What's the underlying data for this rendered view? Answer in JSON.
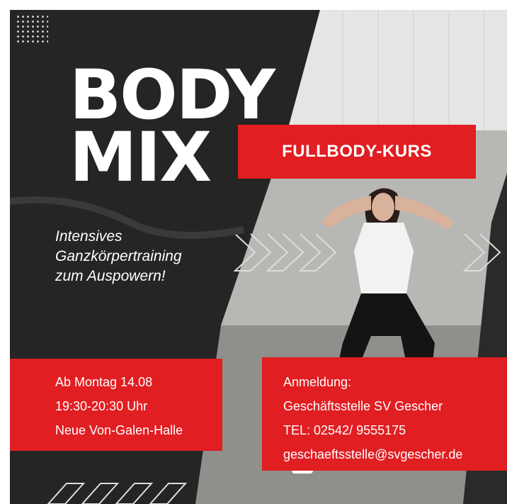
{
  "poster": {
    "title_line1": "BODY",
    "title_line2": "MIX",
    "badge": "FULLBODY-KURS",
    "tagline": [
      "Intensives",
      "Ganzkörpertraining",
      "zum Auspowern!"
    ],
    "schedule": [
      "Ab Montag 14.08",
      "19:30-20:30 Uhr",
      "Neue Von-Galen-Halle"
    ],
    "registration": [
      "Anmeldung:",
      "Geschäftsstelle SV Gescher",
      "TEL: 02542/ 9555175",
      "geschaeftsstelle@svgescher.de"
    ]
  },
  "colors": {
    "accent_red": "#e11e22",
    "dark_background": "#252525",
    "text": "#ffffff"
  },
  "decorations": [
    "dot-grid",
    "chevron-arrows",
    "slash-stripes",
    "woman-dancing-photo"
  ]
}
